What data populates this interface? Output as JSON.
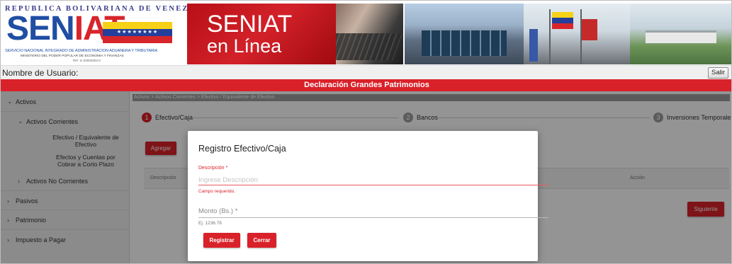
{
  "header": {
    "republic_text": "REPUBLICA BOLIVARIANA DE VENEZUELA",
    "logo_text_blue": "SEN",
    "logo_text_red": "IAT",
    "logo_flag_stars": "★★★★★★★★",
    "agency_name": "SERVICIO NACIONAL INTEGRADO DE ADMINISTRACION ADUANERA Y TRIBUTARIA",
    "ministry": "MINISTERIO DEL PODER POPULAR DE ECONOMIA Y FINANZAS",
    "rif": "RIF: G-20000303-0",
    "banner_line1": "SENIAT",
    "banner_line2": "en Línea",
    "brand_red": "#d9212a",
    "brand_blue": "#1f4ea3"
  },
  "userbar": {
    "user_label": "Nombre de Usuario:",
    "logout_label": "Salir"
  },
  "page_title": "Declaración Grandes Patrimonios",
  "sidebar": {
    "activos": "Activos",
    "activos_corrientes": "Activos Corrientes",
    "efectivo": "Efectivo / Equivalente de Efectivo",
    "efectos_cuentas": "Efectos y Cuentas por Cobrar a Corto Plazo",
    "activos_no_corrientes": "Activos No Corrientes",
    "pasivos": "Pasivos",
    "patrimonio": "Patrimonio",
    "impuesto": "Impuesto a Pagar",
    "chevron_down": "⌄",
    "chevron_right": "›"
  },
  "main": {
    "breadcrumb": "Activos > Activos Corrientes > Efectivo / Equivalente de Efectivo",
    "steps": [
      {
        "num": "1",
        "label": "Efectivo/Caja"
      },
      {
        "num": "2",
        "label": "Bancos"
      },
      {
        "num": "3",
        "label": "Inversiones Temporales"
      }
    ],
    "add_button": "Agregar",
    "table_headers": [
      "Descripción",
      "Acción"
    ],
    "next_button": "Siguiente"
  },
  "modal": {
    "title": "Registro Efectivo/Caja",
    "desc_label": "Descripción *",
    "desc_placeholder": "Ingrese Descripción",
    "desc_value": "",
    "desc_error": "Campo requerido.",
    "monto_placeholder": "Monto (Bs.) *",
    "monto_value": "",
    "monto_hint": "Ej. 1236.78",
    "register_button": "Registrar",
    "close_button": "Cerrar"
  }
}
